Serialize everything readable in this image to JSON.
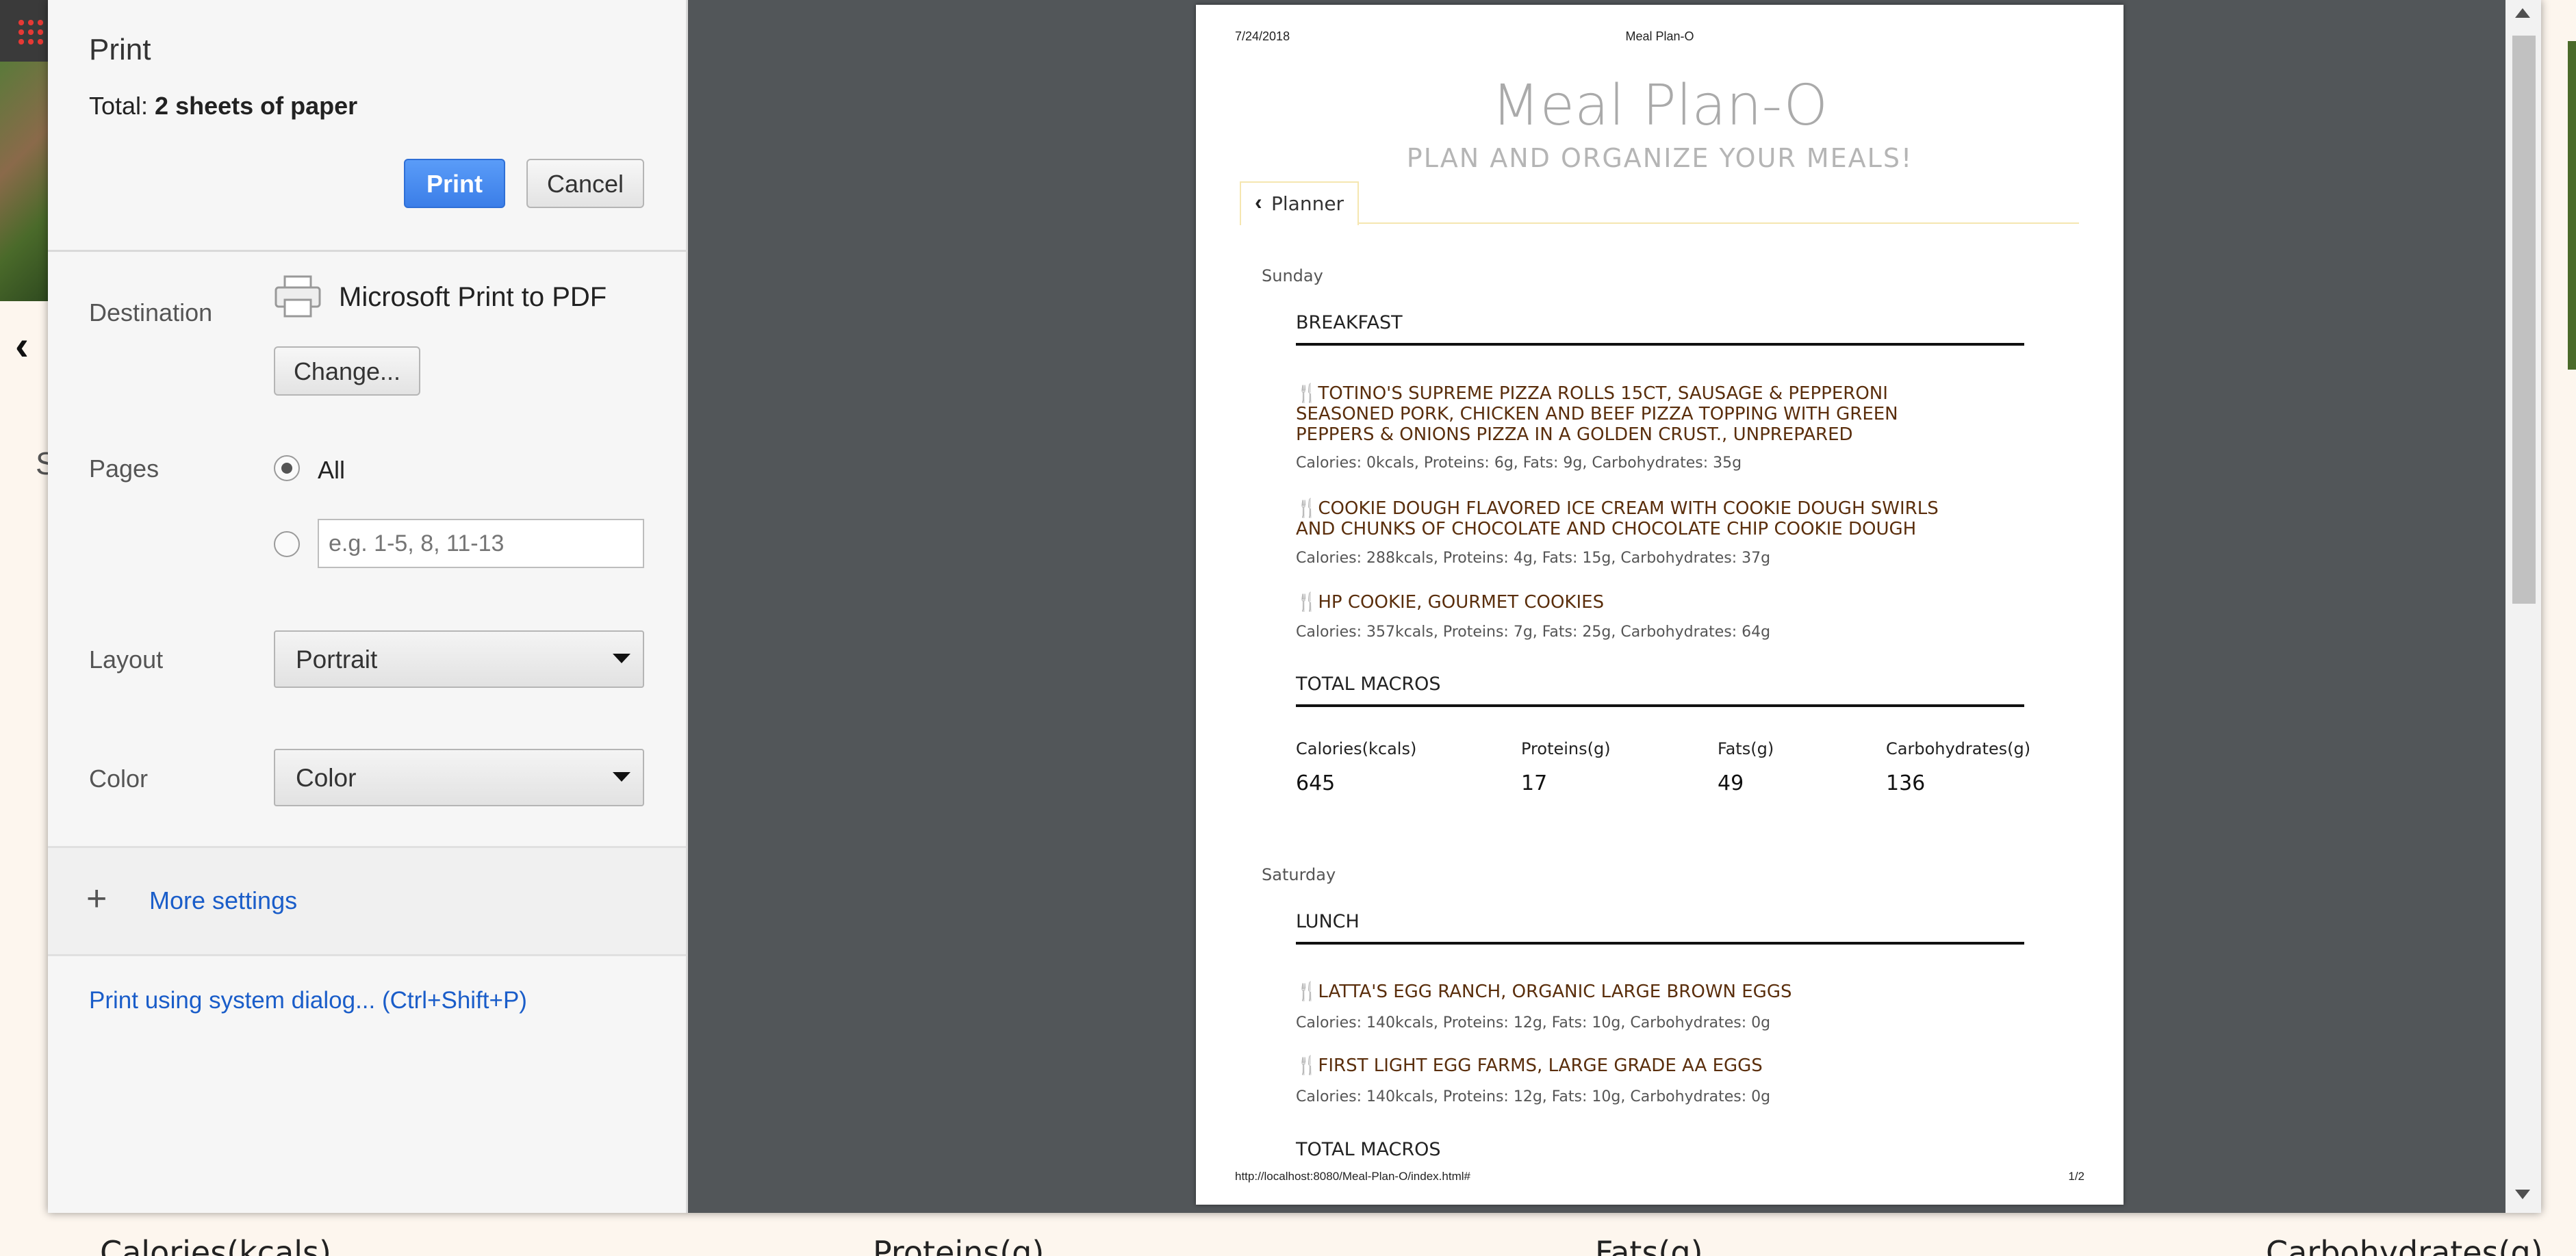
{
  "background": {
    "columns": [
      "Calories(kcals)",
      "Proteins(g)",
      "Fats(g)",
      "Carbohydrates(g)"
    ],
    "partial_letter": "S"
  },
  "print_dialog": {
    "title": "Print",
    "total_prefix": "Total: ",
    "total_value": "2 sheets of paper",
    "print_button": "Print",
    "cancel_button": "Cancel",
    "destination": {
      "label": "Destination",
      "printer": "Microsoft Print to PDF",
      "change_button": "Change..."
    },
    "pages": {
      "label": "Pages",
      "all_label": "All",
      "range_placeholder": "e.g. 1-5, 8, 11-13",
      "selected": "All"
    },
    "layout": {
      "label": "Layout",
      "value": "Portrait"
    },
    "color": {
      "label": "Color",
      "value": "Color"
    },
    "more_settings": "More settings",
    "system_dialog_link": "Print using system dialog... (Ctrl+Shift+P)"
  },
  "preview": {
    "header_date": "7/24/2018",
    "header_title": "Meal Plan-O",
    "footer_url": "http://localhost:8080/Meal-Plan-O/index.html#",
    "footer_page": "1/2",
    "app_title": "Meal Plan-O",
    "app_subtitle": "PLAN AND ORGANIZE YOUR MEALS!",
    "tab_label": "Planner",
    "days": [
      {
        "name": "Sunday",
        "meal": "BREAKFAST",
        "foods": [
          {
            "name": "TOTINO'S SUPREME PIZZA ROLLS 15CT, SAUSAGE & PEPPERONI SEASONED PORK, CHICKEN AND BEEF PIZZA TOPPING WITH GREEN PEPPERS & ONIONS PIZZA IN A GOLDEN CRUST., UNPREPARED",
            "macros": "Calories: 0kcals, Proteins: 6g, Fats: 9g, Carbohydrates: 35g"
          },
          {
            "name": "COOKIE DOUGH FLAVORED ICE CREAM WITH COOKIE DOUGH SWIRLS AND CHUNKS OF CHOCOLATE AND CHOCOLATE CHIP COOKIE DOUGH",
            "macros": "Calories: 288kcals, Proteins: 4g, Fats: 15g, Carbohydrates: 37g"
          },
          {
            "name": "HP COOKIE, GOURMET COOKIES",
            "macros": "Calories: 357kcals, Proteins: 7g, Fats: 25g, Carbohydrates: 64g"
          }
        ],
        "totals_heading": "TOTAL MACROS",
        "totals": {
          "labels": [
            "Calories(kcals)",
            "Proteins(g)",
            "Fats(g)",
            "Carbohydrates(g)"
          ],
          "values": [
            "645",
            "17",
            "49",
            "136"
          ]
        }
      },
      {
        "name": "Saturday",
        "meal": "LUNCH",
        "foods": [
          {
            "name": "LATTA'S EGG RANCH, ORGANIC LARGE BROWN EGGS",
            "macros": "Calories: 140kcals, Proteins: 12g, Fats: 10g, Carbohydrates: 0g"
          },
          {
            "name": "FIRST LIGHT EGG FARMS, LARGE GRADE AA EGGS",
            "macros": "Calories: 140kcals, Proteins: 12g, Fats: 10g, Carbohydrates: 0g"
          }
        ],
        "totals_heading": "TOTAL MACROS"
      }
    ]
  }
}
